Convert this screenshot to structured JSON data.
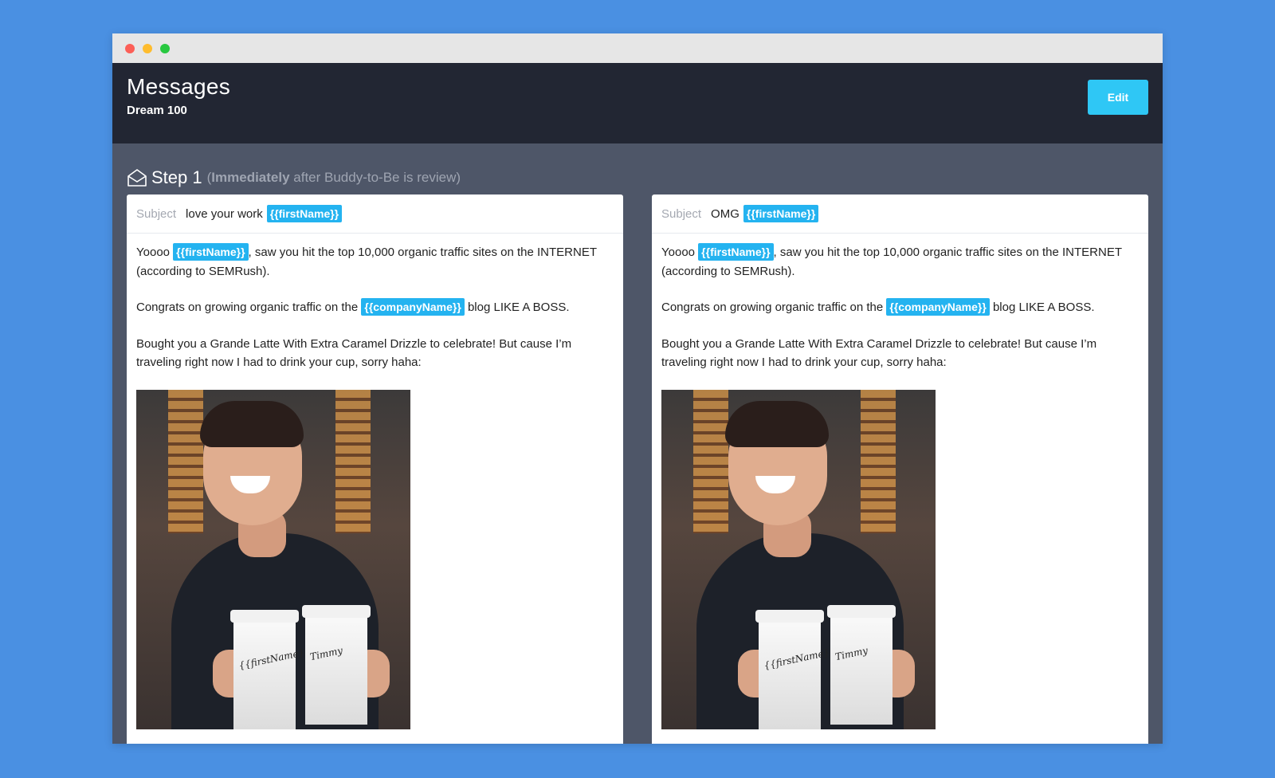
{
  "header": {
    "title": "Messages",
    "subtitle": "Dream 100",
    "edit_label": "Edit"
  },
  "step": {
    "label": "Step 1",
    "open_paren": "(",
    "timing": "Immediately",
    "after_text": " after Buddy-to-Be is review)",
    "icon": "envelope-open-icon"
  },
  "colors": {
    "background": "#4a90e2",
    "header_bg": "#222633",
    "panel_bg": "#4e5668",
    "accent": "#2fc7f5",
    "tag": "#24b3f0"
  },
  "messages": [
    {
      "subject_label": "Subject",
      "subject_text": "love your work",
      "subject_tag": "{{firstName}}",
      "p1_start": "Yoooo ",
      "p1_tag": "{{firstName}}",
      "p1_end": ", saw you hit the top 10,000 organic traffic sites on the INTERNET (according to SEMRush).",
      "p2_start": "Congrats on growing organic traffic on the ",
      "p2_tag": "{{companyName}}",
      "p2_end": " blog LIKE A BOSS.",
      "p3": "Bought you a Grande Latte With Extra Caramel Drizzle to celebrate! But cause I’m traveling right now I had to drink your cup, sorry haha:",
      "cup1_text": "{{firstName}}",
      "cup2_text": "Timmy"
    },
    {
      "subject_label": "Subject",
      "subject_text": "OMG",
      "subject_tag": "{{firstName}}",
      "p1_start": "Yoooo ",
      "p1_tag": "{{firstName}}",
      "p1_end": ", saw you hit the top 10,000 organic traffic sites on the INTERNET (according to SEMRush).",
      "p2_start": "Congrats on growing organic traffic on the ",
      "p2_tag": "{{companyName}}",
      "p2_end": " blog LIKE A BOSS.",
      "p3": "Bought you a Grande Latte With Extra Caramel Drizzle to celebrate! But cause I’m traveling right now I had to drink your cup, sorry haha:",
      "cup1_text": "{{firstName}}",
      "cup2_text": "Timmy"
    }
  ]
}
